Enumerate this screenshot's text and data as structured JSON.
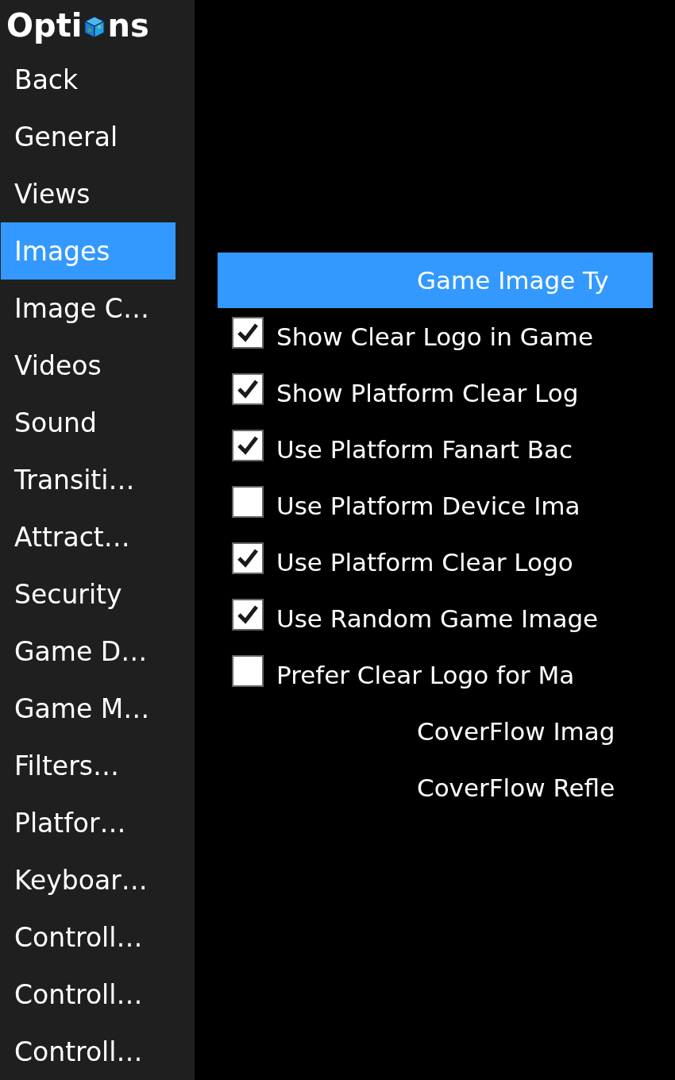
{
  "sidebar": {
    "title_before_icon": "Opti",
    "title_after_icon": "ns",
    "items": [
      {
        "label": "Back",
        "selected": false
      },
      {
        "label": "General",
        "selected": false
      },
      {
        "label": "Views",
        "selected": false
      },
      {
        "label": "Images",
        "selected": true
      },
      {
        "label": "Image C…",
        "selected": false
      },
      {
        "label": "Videos",
        "selected": false
      },
      {
        "label": "Sound",
        "selected": false
      },
      {
        "label": "Transiti…",
        "selected": false
      },
      {
        "label": "Attract…",
        "selected": false
      },
      {
        "label": "Security",
        "selected": false
      },
      {
        "label": "Game D…",
        "selected": false
      },
      {
        "label": "Game M…",
        "selected": false
      },
      {
        "label": "Filters…",
        "selected": false
      },
      {
        "label": "Platfor…",
        "selected": false
      },
      {
        "label": "Keyboar…",
        "selected": false
      },
      {
        "label": "Controll…",
        "selected": false
      },
      {
        "label": "Controll…",
        "selected": false
      },
      {
        "label": "Controll…",
        "selected": false
      }
    ]
  },
  "settings": [
    {
      "kind": "header",
      "label": "Game Image Ty",
      "selected": true
    },
    {
      "kind": "checkbox",
      "label": "Show Clear Logo in Game",
      "checked": true
    },
    {
      "kind": "checkbox",
      "label": "Show Platform Clear Log",
      "checked": true
    },
    {
      "kind": "checkbox",
      "label": "Use Platform Fanart Bac",
      "checked": true
    },
    {
      "kind": "checkbox",
      "label": "Use Platform Device Ima",
      "checked": false
    },
    {
      "kind": "checkbox",
      "label": "Use Platform Clear Logo",
      "checked": true
    },
    {
      "kind": "checkbox",
      "label": "Use Random Game Image",
      "checked": true
    },
    {
      "kind": "checkbox",
      "label": "Prefer Clear Logo for Ma",
      "checked": false
    },
    {
      "kind": "option",
      "label": "CoverFlow Imag"
    },
    {
      "kind": "option",
      "label": "CoverFlow Refle"
    }
  ]
}
